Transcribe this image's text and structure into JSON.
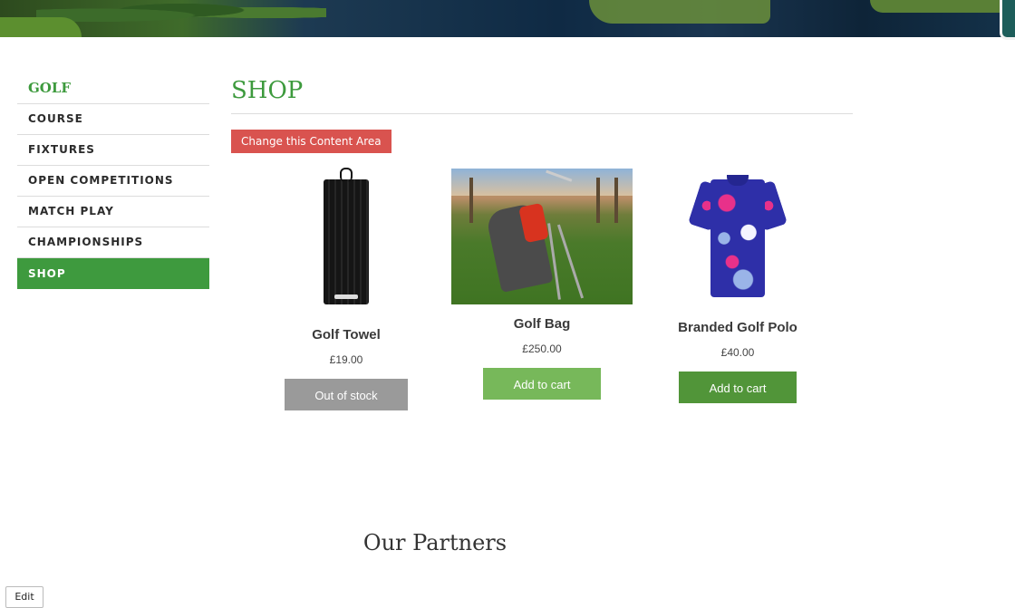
{
  "sidebar": {
    "title": "GOLF",
    "items": [
      {
        "label": "COURSE"
      },
      {
        "label": "FIXTURES"
      },
      {
        "label": "OPEN COMPETITIONS"
      },
      {
        "label": "MATCH PLAY"
      },
      {
        "label": "CHAMPIONSHIPS"
      },
      {
        "label": "SHOP"
      }
    ],
    "active": "SHOP"
  },
  "main": {
    "title": "SHOP",
    "change_button": "Change this Content Area",
    "products": [
      {
        "name": "Golf Towel",
        "price": "£19.00",
        "button": "Out of stock",
        "image_icon": "golf-towel-image"
      },
      {
        "name": "Golf Bag",
        "price": "£250.00",
        "button": "Add to cart",
        "image_icon": "golf-bag-image"
      },
      {
        "name": "Branded Golf Polo",
        "price": "£40.00",
        "button": "Add to cart",
        "image_icon": "golf-polo-image"
      }
    ]
  },
  "partners_heading": "Our Partners",
  "edit_button": "Edit",
  "colors": {
    "accent_green": "#3e9a3e",
    "change_button_red": "#d9534f",
    "out_of_stock_gray": "#9a9a9a",
    "add_to_cart_green": "#519539"
  }
}
